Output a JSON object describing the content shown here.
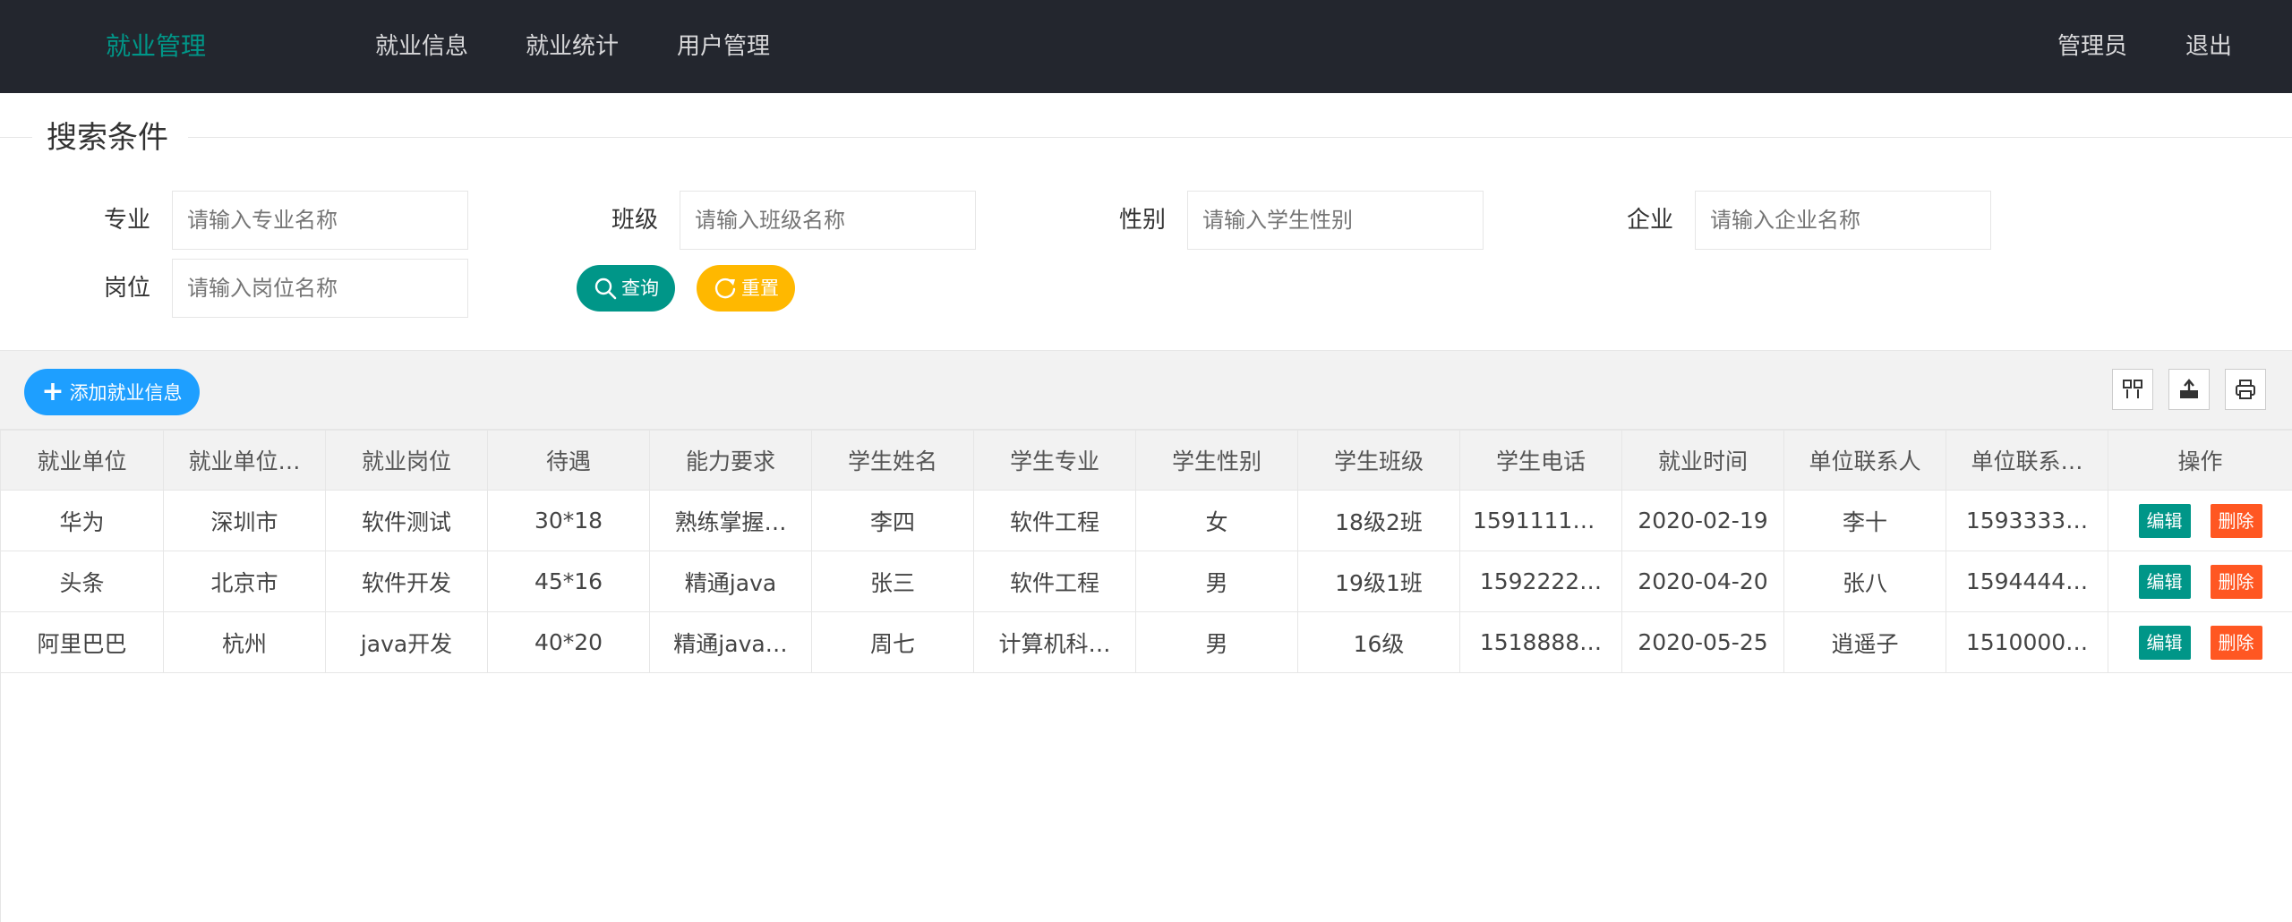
{
  "header": {
    "brand": "就业管理",
    "nav": [
      "就业信息",
      "就业统计",
      "用户管理"
    ],
    "user": "管理员",
    "logout": "退出"
  },
  "search": {
    "title": "搜索条件",
    "fields": [
      {
        "label": "专业",
        "placeholder": "请输入专业名称"
      },
      {
        "label": "班级",
        "placeholder": "请输入班级名称"
      },
      {
        "label": "性别",
        "placeholder": "请输入学生性别"
      },
      {
        "label": "企业",
        "placeholder": "请输入企业名称"
      },
      {
        "label": "岗位",
        "placeholder": "请输入岗位名称"
      }
    ],
    "query_label": "查询",
    "reset_label": "重置"
  },
  "toolbar": {
    "add_label": "添加就业信息",
    "icons": [
      "columns-icon",
      "export-icon",
      "print-icon"
    ]
  },
  "table": {
    "headers": [
      "就业单位",
      "就业单位…",
      "就业岗位",
      "待遇",
      "能力要求",
      "学生姓名",
      "学生专业",
      "学生性别",
      "学生班级",
      "学生电话",
      "就业时间",
      "单位联系人",
      "单位联系…",
      "操作"
    ],
    "rows": [
      [
        "华为",
        "深圳市",
        "软件测试",
        "30*18",
        "熟练掌握…",
        "李四",
        "软件工程",
        "女",
        "18级2班",
        "15911111…",
        "2020-02-19",
        "李十",
        "1593333…"
      ],
      [
        "头条",
        "北京市",
        "软件开发",
        "45*16",
        "精通java",
        "张三",
        "软件工程",
        "男",
        "19级1班",
        "1592222…",
        "2020-04-20",
        "张八",
        "1594444…"
      ],
      [
        "阿里巴巴",
        "杭州",
        "java开发",
        "40*20",
        "精通java…",
        "周七",
        "计算机科…",
        "男",
        "16级",
        "1518888…",
        "2020-05-25",
        "逍遥子",
        "1510000…"
      ]
    ],
    "edit_label": "编辑",
    "delete_label": "删除"
  },
  "colors": {
    "header_bg": "#23262e",
    "brand": "#009688",
    "query": "#009688",
    "reset": "#ffb800",
    "add": "#1e9fff",
    "edit": "#009688",
    "delete": "#ff5722"
  }
}
